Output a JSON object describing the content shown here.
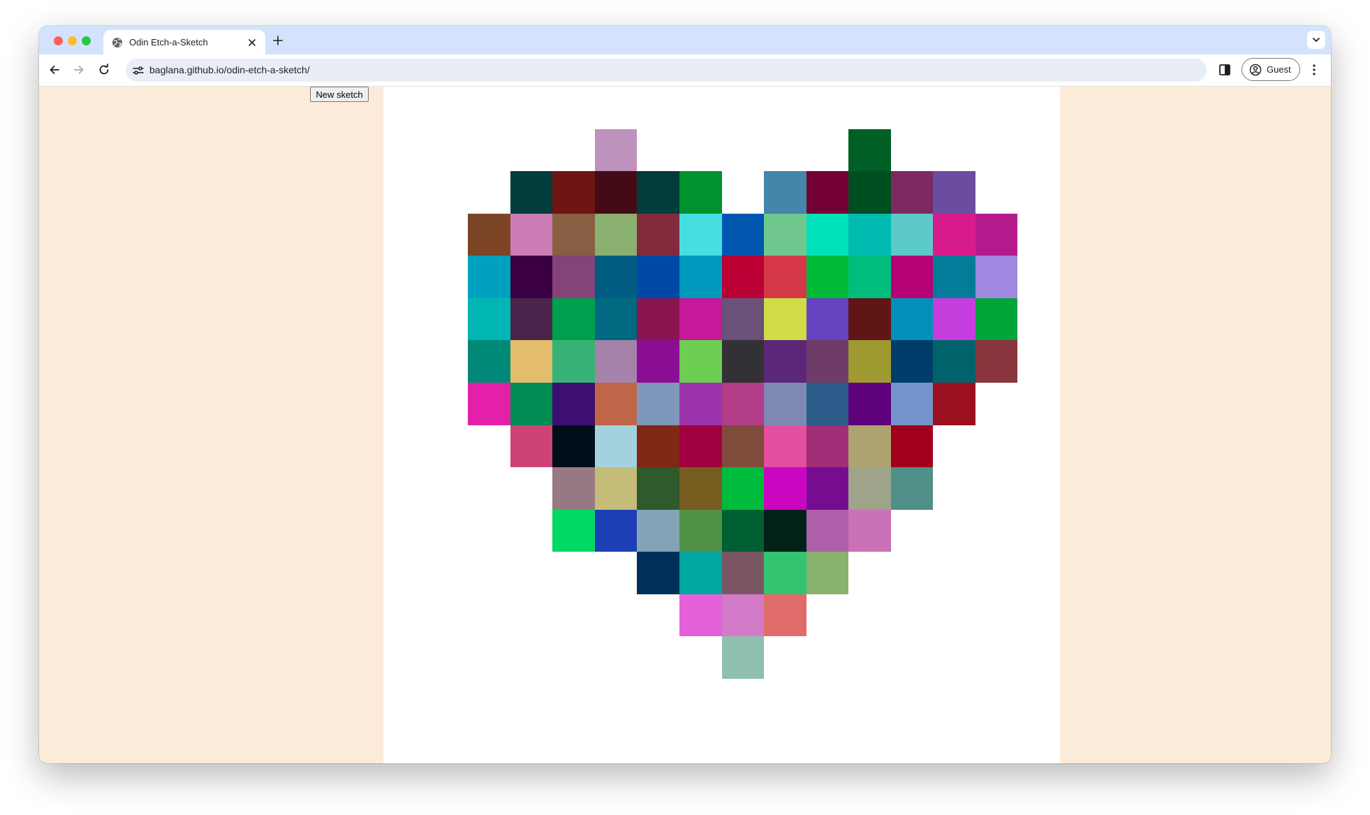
{
  "browser": {
    "tab_title": "Odin Etch-a-Sketch",
    "url": "baglana.github.io/odin-etch-a-sketch/",
    "profile_label": "Guest"
  },
  "page": {
    "new_sketch_label": "New sketch",
    "page_background": "#fdebd9",
    "sketch_background": "#ffffff",
    "grid_size": 16
  },
  "grid": {
    "colored_cells": [
      {
        "row": 1,
        "col": 5,
        "color": "#be92bd"
      },
      {
        "row": 1,
        "col": 11,
        "color": "#005f25"
      },
      {
        "row": 2,
        "col": 3,
        "color": "#003d3b"
      },
      {
        "row": 2,
        "col": 4,
        "color": "#6f1513"
      },
      {
        "row": 2,
        "col": 5,
        "color": "#440b17"
      },
      {
        "row": 2,
        "col": 6,
        "color": "#003c39"
      },
      {
        "row": 2,
        "col": 7,
        "color": "#00922f"
      },
      {
        "row": 2,
        "col": 9,
        "color": "#4386a9"
      },
      {
        "row": 2,
        "col": 10,
        "color": "#720032"
      },
      {
        "row": 2,
        "col": 11,
        "color": "#004f21"
      },
      {
        "row": 2,
        "col": 12,
        "color": "#7e2962"
      },
      {
        "row": 2,
        "col": 13,
        "color": "#6a4d9f"
      },
      {
        "row": 3,
        "col": 2,
        "color": "#7c4525"
      },
      {
        "row": 3,
        "col": 3,
        "color": "#cc7cb5"
      },
      {
        "row": 3,
        "col": 4,
        "color": "#875f42"
      },
      {
        "row": 3,
        "col": 5,
        "color": "#8ab071"
      },
      {
        "row": 3,
        "col": 6,
        "color": "#842a3d"
      },
      {
        "row": 3,
        "col": 7,
        "color": "#45dfe1"
      },
      {
        "row": 3,
        "col": 8,
        "color": "#0157b0"
      },
      {
        "row": 3,
        "col": 9,
        "color": "#6fc78d"
      },
      {
        "row": 3,
        "col": 10,
        "color": "#00e2b9"
      },
      {
        "row": 3,
        "col": 11,
        "color": "#00bbb0"
      },
      {
        "row": 3,
        "col": 12,
        "color": "#5ccac9"
      },
      {
        "row": 3,
        "col": 13,
        "color": "#d81b8c"
      },
      {
        "row": 3,
        "col": 14,
        "color": "#b31b8c"
      },
      {
        "row": 4,
        "col": 2,
        "color": "#00a0bf"
      },
      {
        "row": 4,
        "col": 3,
        "color": "#3b0041"
      },
      {
        "row": 4,
        "col": 4,
        "color": "#844379"
      },
      {
        "row": 4,
        "col": 5,
        "color": "#015c82"
      },
      {
        "row": 4,
        "col": 6,
        "color": "#0048a6"
      },
      {
        "row": 4,
        "col": 7,
        "color": "#0099be"
      },
      {
        "row": 4,
        "col": 8,
        "color": "#bb0035"
      },
      {
        "row": 4,
        "col": 9,
        "color": "#d53847"
      },
      {
        "row": 4,
        "col": 10,
        "color": "#00bb38"
      },
      {
        "row": 4,
        "col": 11,
        "color": "#00bd7e"
      },
      {
        "row": 4,
        "col": 12,
        "color": "#b60174"
      },
      {
        "row": 4,
        "col": 13,
        "color": "#027c98"
      },
      {
        "row": 4,
        "col": 14,
        "color": "#9f89e0"
      },
      {
        "row": 5,
        "col": 2,
        "color": "#00b6b4"
      },
      {
        "row": 5,
        "col": 3,
        "color": "#4a244a"
      },
      {
        "row": 5,
        "col": 4,
        "color": "#00a04e"
      },
      {
        "row": 5,
        "col": 5,
        "color": "#006881"
      },
      {
        "row": 5,
        "col": 6,
        "color": "#891650"
      },
      {
        "row": 5,
        "col": 7,
        "color": "#c6189a"
      },
      {
        "row": 5,
        "col": 8,
        "color": "#6b5079"
      },
      {
        "row": 5,
        "col": 9,
        "color": "#d0dc48"
      },
      {
        "row": 5,
        "col": 10,
        "color": "#6644c1"
      },
      {
        "row": 5,
        "col": 11,
        "color": "#5f1614"
      },
      {
        "row": 5,
        "col": 12,
        "color": "#0090ba"
      },
      {
        "row": 5,
        "col": 13,
        "color": "#c63ddd"
      },
      {
        "row": 5,
        "col": 14,
        "color": "#00a53a"
      },
      {
        "row": 6,
        "col": 2,
        "color": "#008877"
      },
      {
        "row": 6,
        "col": 3,
        "color": "#e3bd6b"
      },
      {
        "row": 6,
        "col": 4,
        "color": "#37b277"
      },
      {
        "row": 6,
        "col": 5,
        "color": "#a582aa"
      },
      {
        "row": 6,
        "col": 6,
        "color": "#8a0f94"
      },
      {
        "row": 6,
        "col": 7,
        "color": "#6cce52"
      },
      {
        "row": 6,
        "col": 8,
        "color": "#323135"
      },
      {
        "row": 6,
        "col": 9,
        "color": "#5c2679"
      },
      {
        "row": 6,
        "col": 10,
        "color": "#6e3c67"
      },
      {
        "row": 6,
        "col": 11,
        "color": "#9e9931"
      },
      {
        "row": 6,
        "col": 12,
        "color": "#003d6a"
      },
      {
        "row": 6,
        "col": 13,
        "color": "#00626a"
      },
      {
        "row": 6,
        "col": 14,
        "color": "#88353e"
      },
      {
        "row": 7,
        "col": 2,
        "color": "#e320a7"
      },
      {
        "row": 7,
        "col": 3,
        "color": "#008c52"
      },
      {
        "row": 7,
        "col": 4,
        "color": "#3d0f71"
      },
      {
        "row": 7,
        "col": 5,
        "color": "#c06548"
      },
      {
        "row": 7,
        "col": 6,
        "color": "#7e97bd"
      },
      {
        "row": 7,
        "col": 7,
        "color": "#9b33aa"
      },
      {
        "row": 7,
        "col": 8,
        "color": "#b13d88"
      },
      {
        "row": 7,
        "col": 9,
        "color": "#7f89b4"
      },
      {
        "row": 7,
        "col": 10,
        "color": "#2c5c8a"
      },
      {
        "row": 7,
        "col": 11,
        "color": "#5f007c"
      },
      {
        "row": 7,
        "col": 12,
        "color": "#7494cc"
      },
      {
        "row": 7,
        "col": 13,
        "color": "#9b101e"
      },
      {
        "row": 8,
        "col": 3,
        "color": "#cf4278"
      },
      {
        "row": 8,
        "col": 4,
        "color": "#000e19"
      },
      {
        "row": 8,
        "col": 5,
        "color": "#a4d1de"
      },
      {
        "row": 8,
        "col": 6,
        "color": "#812715"
      },
      {
        "row": 8,
        "col": 7,
        "color": "#a10040"
      },
      {
        "row": 8,
        "col": 8,
        "color": "#7f4b3b"
      },
      {
        "row": 8,
        "col": 9,
        "color": "#e54fa0"
      },
      {
        "row": 8,
        "col": 10,
        "color": "#a02d76"
      },
      {
        "row": 8,
        "col": 11,
        "color": "#ada270"
      },
      {
        "row": 8,
        "col": 12,
        "color": "#a0001a"
      },
      {
        "row": 9,
        "col": 4,
        "color": "#977984"
      },
      {
        "row": 9,
        "col": 5,
        "color": "#c5bc79"
      },
      {
        "row": 9,
        "col": 6,
        "color": "#2d5b2b"
      },
      {
        "row": 9,
        "col": 7,
        "color": "#765c1f"
      },
      {
        "row": 9,
        "col": 8,
        "color": "#00bc3c"
      },
      {
        "row": 9,
        "col": 9,
        "color": "#ca06c1"
      },
      {
        "row": 9,
        "col": 10,
        "color": "#760d91"
      },
      {
        "row": 9,
        "col": 11,
        "color": "#9ea38a"
      },
      {
        "row": 9,
        "col": 12,
        "color": "#508f88"
      },
      {
        "row": 10,
        "col": 4,
        "color": "#00d862"
      },
      {
        "row": 10,
        "col": 5,
        "color": "#1d3fb6"
      },
      {
        "row": 10,
        "col": 6,
        "color": "#81a4b7"
      },
      {
        "row": 10,
        "col": 7,
        "color": "#4f9145"
      },
      {
        "row": 10,
        "col": 8,
        "color": "#005f33"
      },
      {
        "row": 10,
        "col": 9,
        "color": "#002218"
      },
      {
        "row": 10,
        "col": 10,
        "color": "#b05fab"
      },
      {
        "row": 10,
        "col": 11,
        "color": "#ca71b7"
      },
      {
        "row": 11,
        "col": 6,
        "color": "#00305a"
      },
      {
        "row": 11,
        "col": 7,
        "color": "#00a8a1"
      },
      {
        "row": 11,
        "col": 8,
        "color": "#7a5564"
      },
      {
        "row": 11,
        "col": 9,
        "color": "#32c470"
      },
      {
        "row": 11,
        "col": 10,
        "color": "#8ab26f"
      },
      {
        "row": 12,
        "col": 7,
        "color": "#e360d8"
      },
      {
        "row": 12,
        "col": 8,
        "color": "#d27ac8"
      },
      {
        "row": 12,
        "col": 9,
        "color": "#e06c69"
      },
      {
        "row": 13,
        "col": 8,
        "color": "#8fbfb1"
      }
    ]
  }
}
